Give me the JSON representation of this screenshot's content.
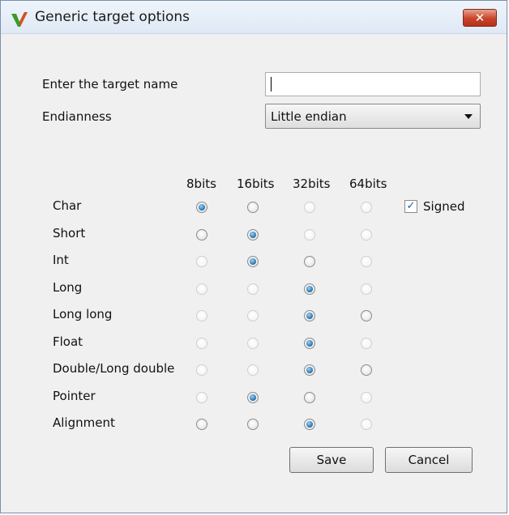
{
  "window": {
    "title": "Generic target options",
    "close_label": "✕"
  },
  "form": {
    "target_name_label": "Enter the target name",
    "target_name_value": "",
    "endianness_label": "Endianness",
    "endianness_value": "Little endian"
  },
  "columns": [
    "8bits",
    "16bits",
    "32bits",
    "64bits"
  ],
  "rows": [
    {
      "label": "Char",
      "states": [
        "checked",
        "enabled",
        "disabled",
        "disabled"
      ]
    },
    {
      "label": "Short",
      "states": [
        "enabled",
        "checked",
        "disabled",
        "disabled"
      ]
    },
    {
      "label": "Int",
      "states": [
        "disabled",
        "checked",
        "enabled",
        "disabled"
      ]
    },
    {
      "label": "Long",
      "states": [
        "disabled",
        "disabled",
        "checked",
        "disabled"
      ]
    },
    {
      "label": "Long long",
      "states": [
        "disabled",
        "disabled",
        "checked",
        "enabled"
      ]
    },
    {
      "label": "Float",
      "states": [
        "disabled",
        "disabled",
        "checked",
        "disabled"
      ]
    },
    {
      "label": "Double/Long double",
      "states": [
        "disabled",
        "disabled",
        "checked",
        "enabled"
      ]
    },
    {
      "label": "Pointer",
      "states": [
        "disabled",
        "checked",
        "enabled",
        "disabled"
      ]
    },
    {
      "label": "Alignment",
      "states": [
        "enabled",
        "enabled",
        "checked",
        "disabled"
      ]
    }
  ],
  "signed": {
    "label": "Signed",
    "checked": true
  },
  "buttons": {
    "save": "Save",
    "cancel": "Cancel"
  },
  "icons": {
    "app": "matlab-v-icon",
    "close": "close-icon"
  },
  "colors": {
    "close_red": "#c8432a",
    "radio_blue": "#1f6fae",
    "title_bg": "#dfe9f5"
  }
}
